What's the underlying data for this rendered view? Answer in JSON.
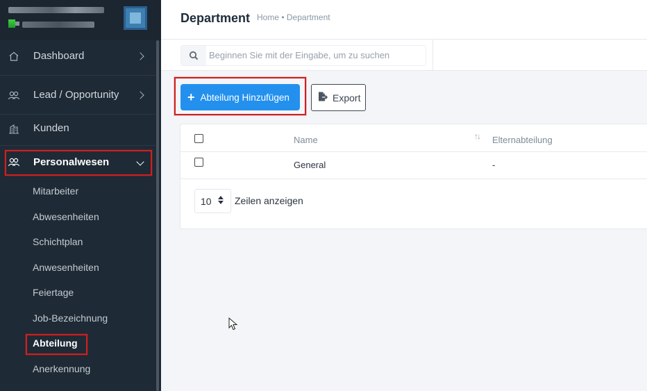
{
  "header": {
    "title": "Department",
    "breadcrumb": "Home • Department"
  },
  "search": {
    "placeholder": "Beginnen Sie mit der Eingabe, um zu suchen"
  },
  "sidebar": {
    "items": [
      {
        "label": "Dashboard",
        "icon": "home-icon",
        "has_chevron": true
      },
      {
        "label": "Lead / Opportunity",
        "icon": "users-icon",
        "has_chevron": true
      },
      {
        "label": "Kunden",
        "icon": "building-icon",
        "has_chevron": false
      },
      {
        "label": "Personalwesen",
        "icon": "users-icon",
        "has_chevron": true,
        "expanded": true
      }
    ],
    "subitems": [
      {
        "label": "Mitarbeiter"
      },
      {
        "label": "Abwesenheiten"
      },
      {
        "label": "Schichtplan"
      },
      {
        "label": "Anwesenheiten"
      },
      {
        "label": "Feiertage"
      },
      {
        "label": "Job-Bezeichnung"
      },
      {
        "label": "Abteilung",
        "active": true
      },
      {
        "label": "Anerkennung"
      }
    ]
  },
  "toolbar": {
    "add_label": "Abteilung Hinzufügen",
    "export_label": "Export"
  },
  "table": {
    "columns": [
      "Name",
      "Elternabteilung"
    ],
    "rows": [
      {
        "name": "General",
        "parent": "-"
      }
    ]
  },
  "pagination": {
    "page_size": "10",
    "rows_label": "Zeilen anzeigen"
  },
  "colors": {
    "sidebar_bg": "#1e2a35",
    "primary": "#2390ee",
    "highlight": "#d01f1f"
  }
}
